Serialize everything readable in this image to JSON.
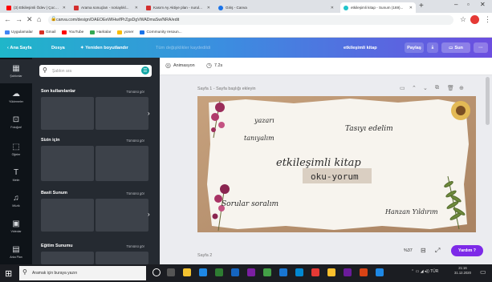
{
  "browser": {
    "tabs": [
      {
        "title": "(3) Etkileşimli Ödev | Çocukl...",
        "color": "#ff0000"
      },
      {
        "title": "Arama sonuçları - noriaylıkl...",
        "color": "#d32f2f"
      },
      {
        "title": "Kasım Ay Aktiye plan - nurul...",
        "color": "#d32f2f"
      },
      {
        "title": "Giriş - Canva",
        "color": "#1a73e8"
      },
      {
        "title": "etkileşimli kitap - Sunum (169)...",
        "color": "#20c4cb"
      }
    ],
    "new_tab": "+",
    "url": "canva.com/design/DAEOEeWlHw/fPrZgsDgVWADmaSw/NRA/edit",
    "bookmarks": [
      "Uygulamalar",
      "Gmail",
      "YouTube",
      "Haritalar",
      "yoner",
      "Community resoun..."
    ]
  },
  "canva_bar": {
    "home": "Ana Sayfa",
    "file": "Dosya",
    "resize": "Yeniden boyutlandır",
    "saved": "Tüm değişiklikler kaydedildi",
    "title": "etkileşimli kitap",
    "share": "Paylaş",
    "download_icon": "download-icon",
    "present": "Sun",
    "more": "···"
  },
  "rail": [
    {
      "label": "Şablonlar",
      "icon": "▦"
    },
    {
      "label": "Yüklemeler",
      "icon": "☁"
    },
    {
      "label": "Fotoğraf",
      "icon": "⊡"
    },
    {
      "label": "Öğeler",
      "icon": "⬚"
    },
    {
      "label": "Metin",
      "icon": "T"
    },
    {
      "label": "Müzik",
      "icon": "♫"
    },
    {
      "label": "Videolar",
      "icon": "▣"
    },
    {
      "label": "Arka Plan",
      "icon": "▤"
    }
  ],
  "panel": {
    "search_placeholder": "Şablon ara",
    "see_all": "Tümünü gör",
    "sections": [
      "Son kullanılanlar",
      "Sizin için",
      "Basit Sunum",
      "Eğitim Sunumu"
    ]
  },
  "toolbar": {
    "animate": "Animasyon",
    "duration": "7.2s"
  },
  "page1_label": "Sayfa 1 - Sayfa başlığı ekleyin",
  "page2_label": "Sayfa 2",
  "zoom": "%37",
  "help": "Yardım ?",
  "design": {
    "t1": "yazarı",
    "t2": "tanıyalım",
    "t3": "Tasıyı edelim",
    "t4": "etkileşimli kitap",
    "t5": "oku-yorum",
    "t6": "Sorular soralım",
    "t7": "Hanzan Yıldırım"
  },
  "taskbar": {
    "search": "Aramak için buraya yazın",
    "tray": "⌃ ▭ ◢ ◂)) TÜR",
    "time": "21:16",
    "date": "31.12.2020"
  }
}
